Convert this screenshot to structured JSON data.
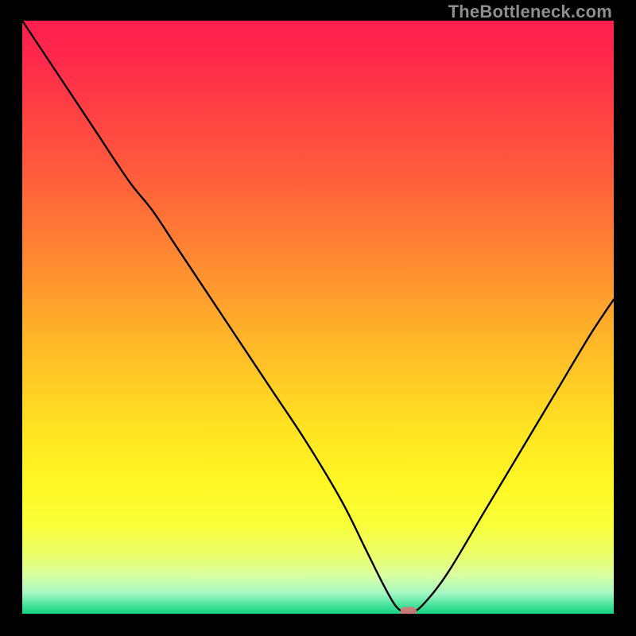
{
  "watermark": "TheBottleneck.com",
  "colors": {
    "curve": "#000000",
    "marker": "#cf7a78",
    "frame": "#000000"
  },
  "gradient_stops": [
    {
      "offset": 0.0,
      "color": "#ff1f4f"
    },
    {
      "offset": 0.07,
      "color": "#ff2a4b"
    },
    {
      "offset": 0.16,
      "color": "#ff4243"
    },
    {
      "offset": 0.25,
      "color": "#ff5a3d"
    },
    {
      "offset": 0.34,
      "color": "#ff7536"
    },
    {
      "offset": 0.43,
      "color": "#ff9230"
    },
    {
      "offset": 0.52,
      "color": "#ffb02a"
    },
    {
      "offset": 0.61,
      "color": "#ffcc25"
    },
    {
      "offset": 0.7,
      "color": "#ffe622"
    },
    {
      "offset": 0.78,
      "color": "#fff724"
    },
    {
      "offset": 0.85,
      "color": "#f8ff3a"
    },
    {
      "offset": 0.9,
      "color": "#ecff6a"
    },
    {
      "offset": 0.935,
      "color": "#d9ffa0"
    },
    {
      "offset": 0.965,
      "color": "#a6f8c4"
    },
    {
      "offset": 0.985,
      "color": "#4be39e"
    },
    {
      "offset": 1.0,
      "color": "#17d181"
    }
  ],
  "chart_data": {
    "type": "line",
    "title": "",
    "xlabel": "",
    "ylabel": "",
    "xlim": [
      0,
      100
    ],
    "ylim": [
      0,
      100
    ],
    "grid": false,
    "legend": false,
    "series": [
      {
        "name": "bottleneck-curve",
        "x": [
          0,
          6,
          12,
          18,
          22,
          26,
          30,
          36,
          42,
          48,
          54,
          58,
          61,
          63,
          64.5,
          66,
          68,
          72,
          78,
          84,
          90,
          96,
          100
        ],
        "y": [
          100,
          91,
          82,
          73,
          68,
          62,
          56,
          47,
          38,
          29,
          19,
          11,
          5,
          1.5,
          0.3,
          0.3,
          1.8,
          7,
          17,
          27,
          37,
          47,
          53
        ]
      }
    ],
    "marker": {
      "x": 65.3,
      "y": 0.3,
      "width_frac": 0.028,
      "height_frac": 0.017
    }
  }
}
